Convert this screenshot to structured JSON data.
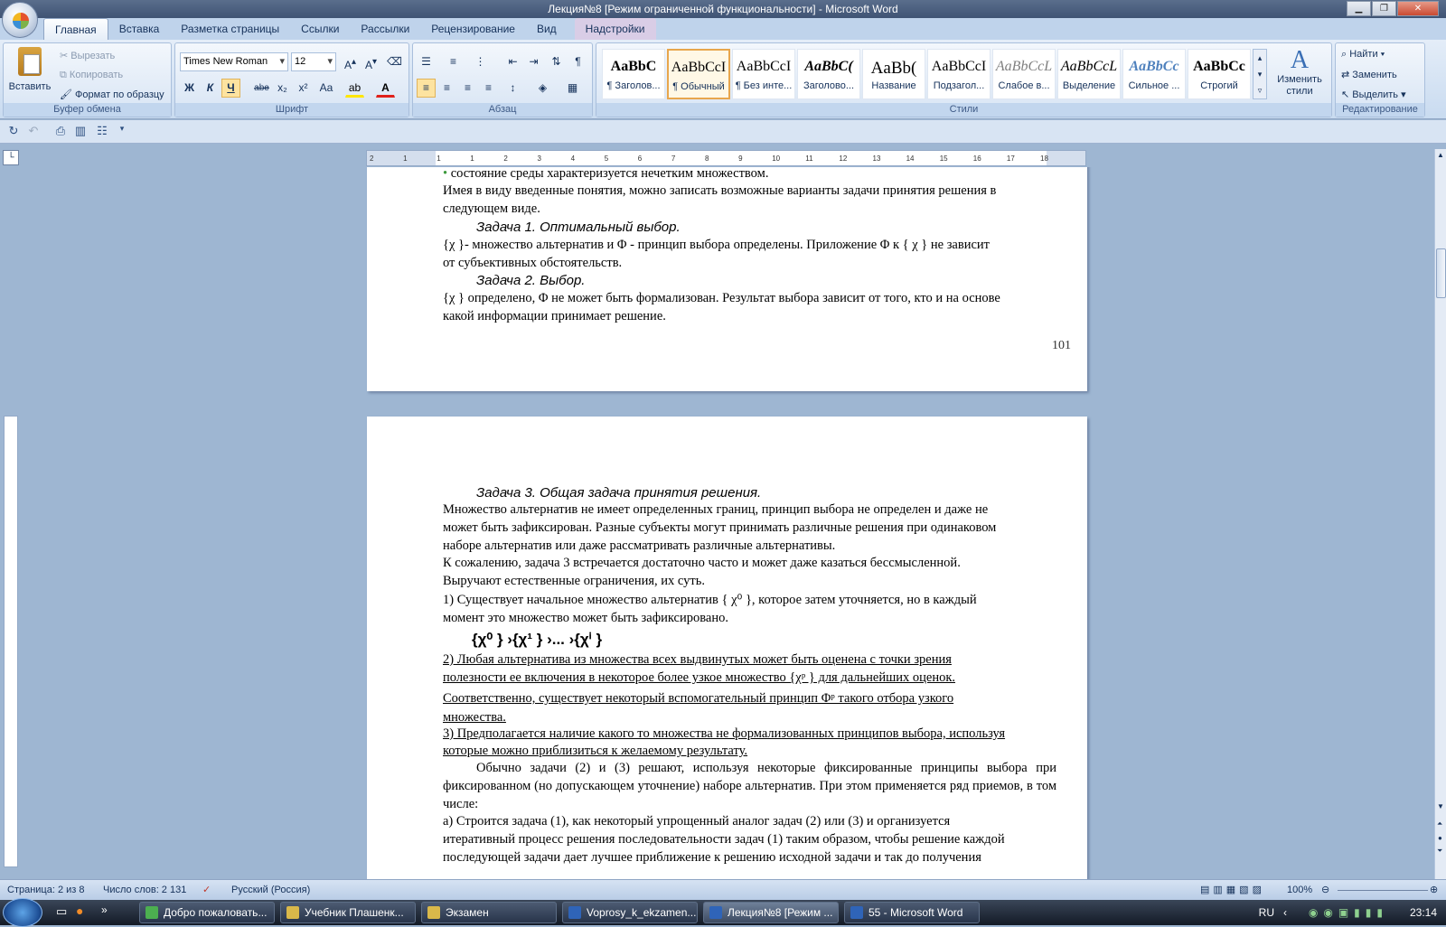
{
  "window": {
    "title": "Лекция№8 [Режим ограниченной функциональности] - Microsoft Word"
  },
  "tabs": [
    "Главная",
    "Вставка",
    "Разметка страницы",
    "Ссылки",
    "Рассылки",
    "Рецензирование",
    "Вид",
    "Надстройки"
  ],
  "ribbon": {
    "clipboard": {
      "label": "Буфер обмена",
      "paste": "Вставить",
      "cut": "Вырезать",
      "copy": "Копировать",
      "format_painter": "Формат по образцу"
    },
    "font": {
      "label": "Шрифт",
      "font_name": "Times New Roman",
      "font_size": "12",
      "bold": "Ж",
      "italic": "К",
      "underline": "Ч",
      "strike": "abe",
      "subscript": "x₂",
      "superscript": "x²",
      "change_case": "Aa"
    },
    "paragraph": {
      "label": "Абзац"
    },
    "styles": {
      "label": "Стили",
      "items": [
        {
          "sample": "AaBbC",
          "name": "¶ Заголов..."
        },
        {
          "sample": "AaBbCcI",
          "name": "¶ Обычный"
        },
        {
          "sample": "AaBbCcI",
          "name": "¶ Без инте..."
        },
        {
          "sample": "AaBbC(",
          "name": "Заголово..."
        },
        {
          "sample": "AaBb(",
          "name": "Название"
        },
        {
          "sample": "AaBbCcI",
          "name": "Подзагол..."
        },
        {
          "sample": "AaBbCcL",
          "name": "Слабое в..."
        },
        {
          "sample": "AaBbCcL",
          "name": "Выделение"
        },
        {
          "sample": "AaBbCc",
          "name": "Сильное ..."
        },
        {
          "sample": "AaBbCc",
          "name": "Строгий"
        }
      ],
      "change_styles": "Изменить стили"
    },
    "editing": {
      "label": "Редактирование",
      "find": "Найти",
      "replace": "Заменить",
      "select": "Выделить"
    }
  },
  "ruler": {
    "numbers": [
      "2",
      "1",
      "1",
      "1",
      "2",
      "3",
      "4",
      "5",
      "6",
      "7",
      "8",
      "9",
      "10",
      "11",
      "12",
      "13",
      "14",
      "15",
      "16",
      "17",
      "18"
    ]
  },
  "page1": {
    "bullet_line": "состояние среды характеризуется нечетким множеством.",
    "p1": "Имея в виду введенные понятия, можно записать возможные варианты задачи принятия решения в",
    "p1b": "следующем виде.",
    "task1": "Задача 1. Оптимальный выбор.",
    "t1_line1": "{χ }- множество альтернатив и Φ - принцип выбора определены. Приложение Φ к { χ } не зависит",
    "t1_line2": "от субъективных обстоятельств.",
    "task2": "Задача 2. Выбор.",
    "t2_line1": "{χ } определено, Φ не может быть формализован. Результат выбора зависит от того, кто и на основе",
    "t2_line2": "какой информации принимает решение.",
    "page_number": "101"
  },
  "page2": {
    "task3": "Задача 3. Общая задача принятия решения.",
    "lines": [
      "Множество альтернатив не имеет определенных границ, принцип выбора не определен и даже не",
      "может быть зафиксирован. Разные субъекты могут принимать различные решения при одинаковом",
      "наборе альтернатив или даже рассматривать различные альтернативы.",
      "К сожалению, задача 3 встречается достаточно часто и может даже казаться бессмысленной.",
      "Выручают естественные ограничения, их суть.",
      "1) Существует начальное множество альтернатив { χ⁰ }, которое затем уточняется, но в каждый",
      "момент это множество может быть зафиксировано."
    ],
    "formula": "{χ⁰ }  ›{χ¹ }  ›...  ›{χⁱ }",
    "lines2": [
      "2) Любая альтернатива из множества всех выдвинутых может быть оценена с точки зрения",
      "полезности ее включения в некоторое более узкое множество {χᵖ } для дальнейших оценок.",
      "Соответственно, существует некоторый вспомогательный принцип Φᵖ такого отбора узкого",
      "множества.",
      "3) Предполагается наличие какого то множества не формализованных принципов выбора, используя",
      "которые можно приблизиться к желаемому результату."
    ],
    "para_justified": "Обычно задачи (2) и (3) решают, используя некоторые фиксированные принципы выбора при фиксированном (но допускающем уточнение) наборе альтернатив. При этом применяется ряд приемов, в том числе:",
    "lines3": [
      "а) Строится задача (1), как некоторый упрощенный аналог задач (2) или (3) и организуется",
      "итеративный процесс решения последовательности задач (1) таким образом, чтобы решение каждой",
      "последующей задачи дает лучшее приближение к решению исходной задачи и так до получения"
    ]
  },
  "status": {
    "page": "Страница: 2 из 8",
    "words": "Число слов: 2 131",
    "language": "Русский (Россия)",
    "zoom": "100%"
  },
  "taskbar": {
    "items": [
      "Добро пожаловать...",
      "Учебник Плашенк...",
      "Экзамен",
      "Voprosy_k_ekzamen...",
      "Лекция№8 [Режим ...",
      "55 - Microsoft Word"
    ],
    "lang": "RU",
    "time": "23:14"
  },
  "colors": {
    "accent": "#e8a64d",
    "ribbon_bg": "#c9dbf0",
    "spell_underline": "#3c9a3c"
  }
}
